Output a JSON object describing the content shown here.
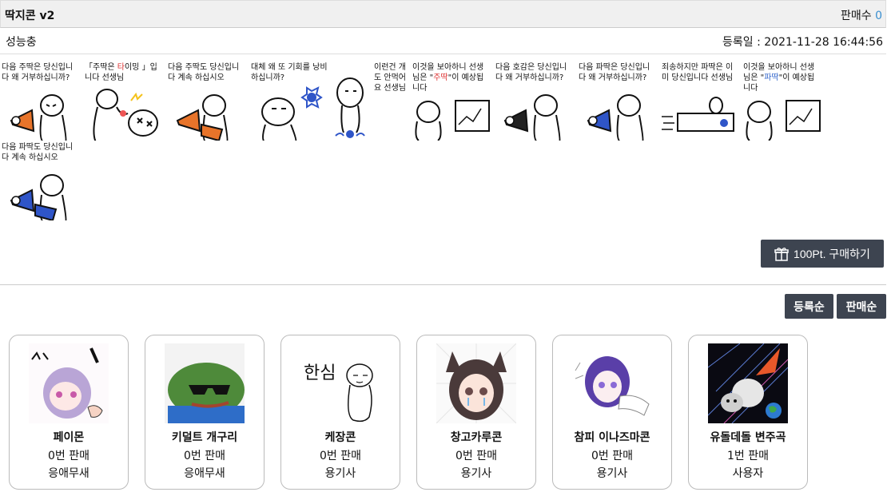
{
  "header": {
    "title": "딱지콘 v2",
    "sales_label": "판매수",
    "sales_count": "0"
  },
  "meta": {
    "author": "성능충",
    "date": "등록일 : 2021-11-28 16:44:56"
  },
  "stickers": [
    {
      "caption": "다음 주딱은 당신입니다 왜 거부하십니까?"
    },
    {
      "caption_pre": "「주딱은 ",
      "caption_hl": "타",
      "caption_post": "이밍 」입니다 선생님"
    },
    {
      "caption": "다음 주딱도 당신입니다 계속 하십시오"
    },
    {
      "caption": "대체 왜 또 기회를 낭비하십니까?"
    },
    {
      "caption": "이런건 개도 안먹어요 선생님"
    },
    {
      "caption_pre": "이것을 보아하니 선생님은 \"",
      "caption_hl": "주딱",
      "caption_post": "\"이 예상됩니다"
    },
    {
      "caption": "다음 호감은 당신입니다 왜 거부하십니까?"
    },
    {
      "caption": "다음 파딱은 당신입니다 왜 거부하십니까?"
    },
    {
      "caption": "죄송하지만 파딱은 이미 당신입니다 선생님"
    },
    {
      "caption_pre": "이것을 보아하니 선생님은 \"",
      "caption_hl": "파딱",
      "caption_post": "\"이 예상됩니다"
    },
    {
      "caption": "다음 파딱도 당신입니다 계속 하십시오"
    }
  ],
  "buy_button": "100Pt. 구매하기",
  "sort": {
    "by_date": "등록순",
    "by_sales": "판매순"
  },
  "cards": [
    {
      "name": "페이몬",
      "count": "0번 판매",
      "seller": "응애무새"
    },
    {
      "name": "키덜트 개구리",
      "count": "0번 판매",
      "seller": "응애무새"
    },
    {
      "name": "케장콘",
      "count": "0번 판매",
      "seller": "용기사",
      "thumb_text": "한심"
    },
    {
      "name": "창고카루콘",
      "count": "0번 판매",
      "seller": "용기사"
    },
    {
      "name": "참피 이나즈마콘",
      "count": "0번 판매",
      "seller": "용기사"
    },
    {
      "name": "유돌데돌 변주곡",
      "count": "1번 판매",
      "seller": "사용자"
    }
  ],
  "colors": {
    "button_bg": "#3d4450",
    "sales_count": "#3a8fd0",
    "megaphone_orange": "#e8742a",
    "megaphone_blue": "#2f55c8",
    "megaphone_black": "#222222"
  }
}
